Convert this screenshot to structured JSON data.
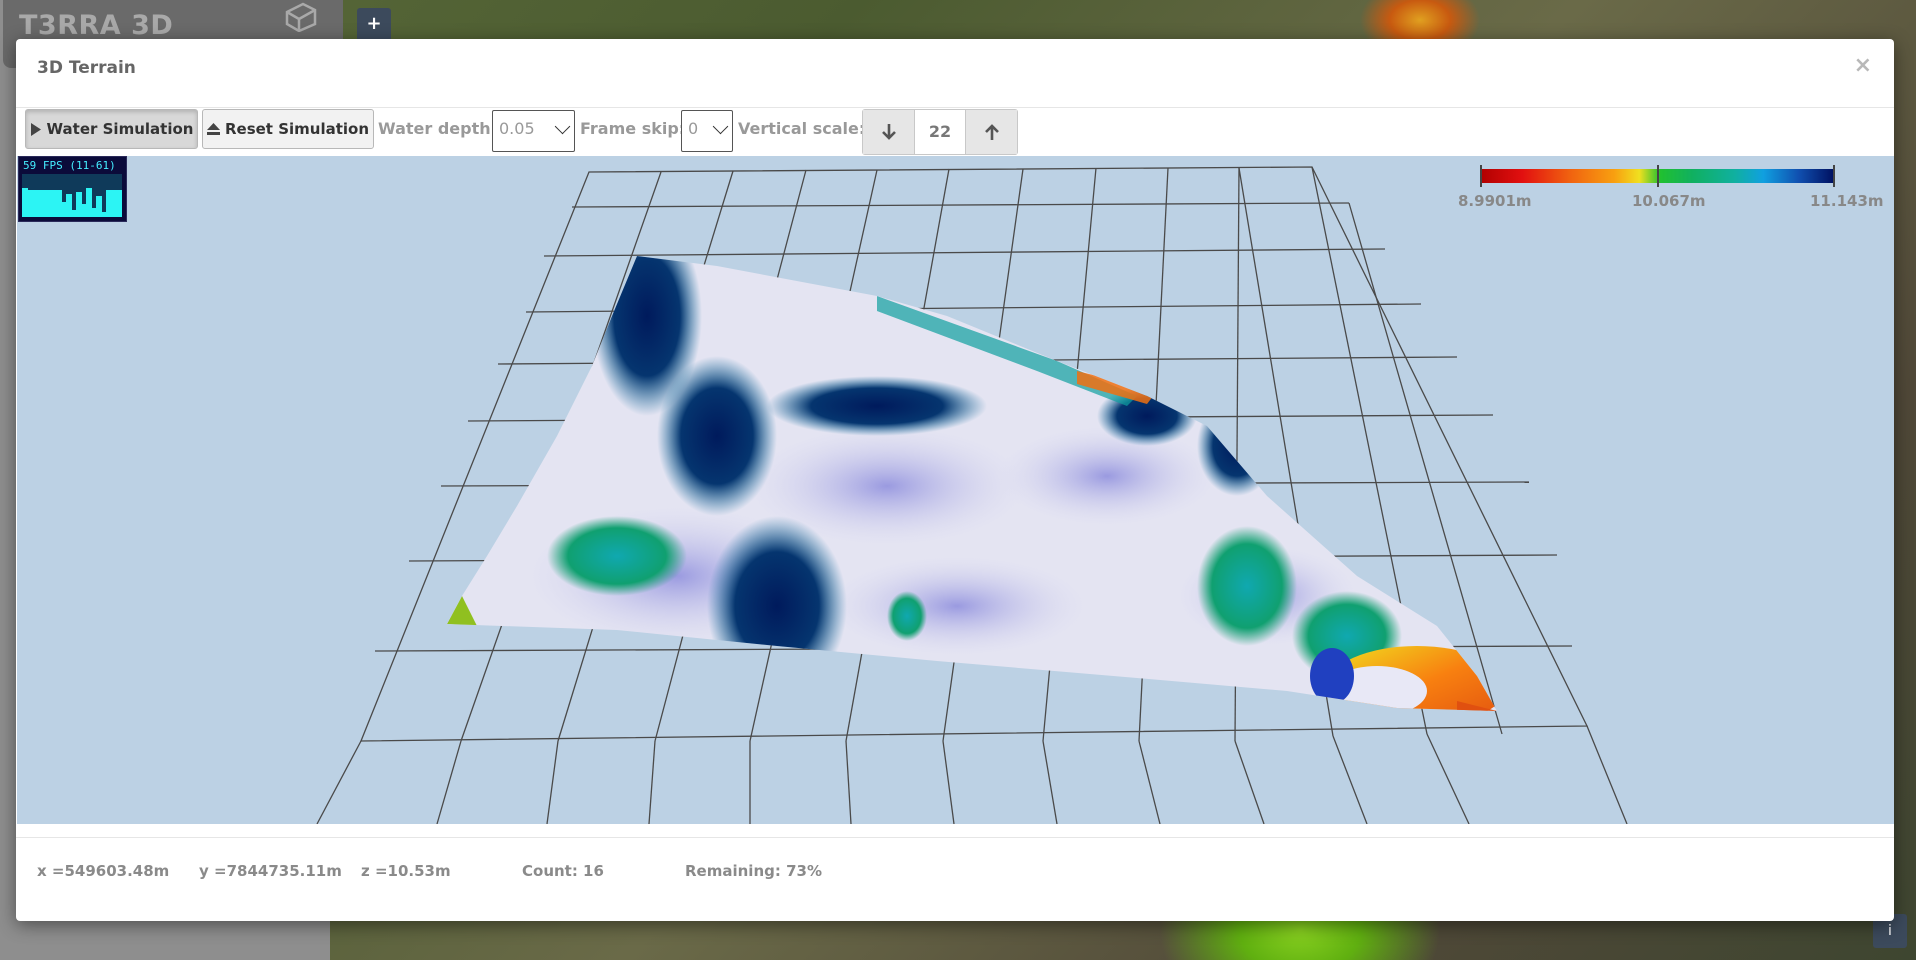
{
  "background": {
    "logo": "T3RRA 3D",
    "plus_label": "+",
    "corner_btn_label": "i"
  },
  "modal": {
    "title": "3D Terrain",
    "close_label": "×"
  },
  "toolbar": {
    "water_sim_label": "Water Simulation",
    "reset_sim_label": "Reset Simulation",
    "water_depth_label": "Water depth:",
    "water_depth_value": "0.05",
    "frame_skip_label": "Frame skip:",
    "frame_skip_value": "0",
    "vertical_scale_label": "Vertical scale:",
    "vertical_scale_value": "22"
  },
  "viewport": {
    "fps_text": "59 FPS (11-61)",
    "legend": {
      "min_label": "8.9901m",
      "mid_label": "10.067m",
      "max_label": "11.143m",
      "colors": [
        "#b00000",
        "#f06010",
        "#f0e020",
        "#20c030",
        "#10b0a0",
        "#10a0e0",
        "#001060"
      ]
    }
  },
  "footer": {
    "x": "x =549603.48m",
    "y": "y =7844735.11m",
    "z": "z =10.53m",
    "count": "Count: 16",
    "remaining": "Remaining: 73%"
  }
}
